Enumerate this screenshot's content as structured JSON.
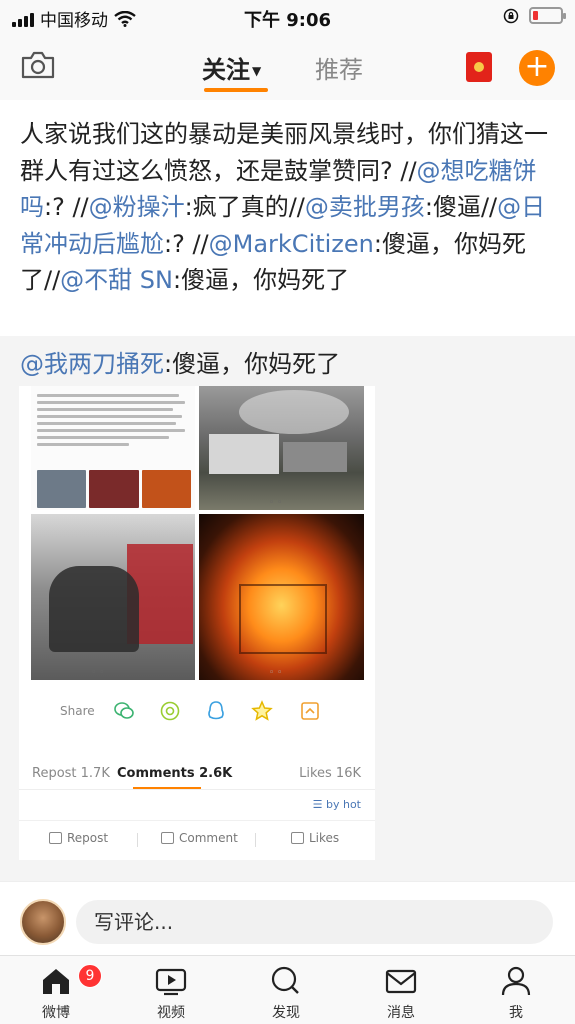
{
  "status_bar": {
    "carrier": "中国移动",
    "time": "下午 9:06"
  },
  "nav": {
    "tab_follow": "关注",
    "tab_recommend": "推荐"
  },
  "post": {
    "segments": [
      {
        "text": "人家说我们这的暴动是美丽风景线时，你们猜这一群人有过这么愤怒，还是鼓掌赞同? //",
        "mention": false
      },
      {
        "text": "@想吃糖饼吗",
        "mention": true
      },
      {
        "text": ":? //",
        "mention": false
      },
      {
        "text": "@粉操汁",
        "mention": true
      },
      {
        "text": ":疯了真的//",
        "mention": false
      },
      {
        "text": "@卖批男孩",
        "mention": true
      },
      {
        "text": ":傻逼//",
        "mention": false
      },
      {
        "text": "@日常冲动后尴尬",
        "mention": true
      },
      {
        "text": ":? //",
        "mention": false
      },
      {
        "text": "@MarkCitizen",
        "mention": true
      },
      {
        "text": ":傻逼，你妈死了//",
        "mention": false
      },
      {
        "text": "@不甜 SN",
        "mention": true
      },
      {
        "text": ":傻逼，你妈死了",
        "mention": false
      }
    ]
  },
  "quoted": {
    "mention": "@我两刀捅死",
    "text": ":傻逼，你妈死了",
    "card": {
      "share_label": "Share",
      "repost_stat": "Repost 1.7K",
      "comments_stat": "Comments 2.6K",
      "likes_stat": "Likes 16K",
      "sort_label": "by hot",
      "repost_action": "Repost",
      "comment_action": "Comment",
      "likes_action": "Likes"
    }
  },
  "composer": {
    "placeholder": "写评论..."
  },
  "tabbar": {
    "items": [
      {
        "label": "微博"
      },
      {
        "label": "视频"
      },
      {
        "label": "发现"
      },
      {
        "label": "消息"
      },
      {
        "label": "我"
      }
    ],
    "badge_count": "9"
  },
  "colors": {
    "accent": "#ff8200",
    "mention": "#4a77b5",
    "badge": "#ff3333"
  }
}
